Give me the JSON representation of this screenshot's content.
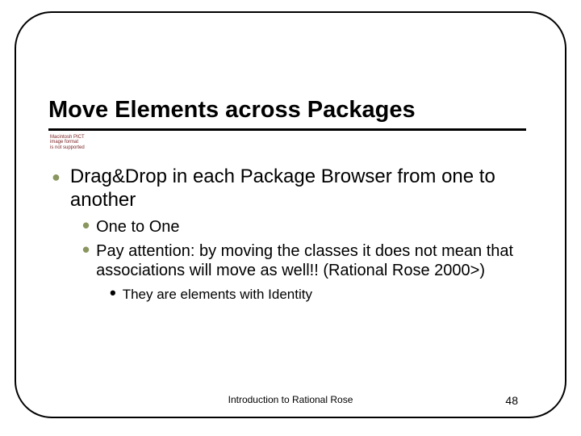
{
  "slide": {
    "title": "Move Elements across Packages",
    "placeholder_lines": [
      "Macintosh PICT",
      "image format",
      "is not supported"
    ],
    "level1": "Drag&Drop in each Package Browser from one to another",
    "level2": [
      "One to One",
      "Pay attention: by moving the classes it does not mean that associations will move as well!! (Rational Rose 2000>)"
    ],
    "level3": "They are elements with Identity",
    "footer_center": "Introduction to Rational Rose",
    "page_number": "48"
  }
}
